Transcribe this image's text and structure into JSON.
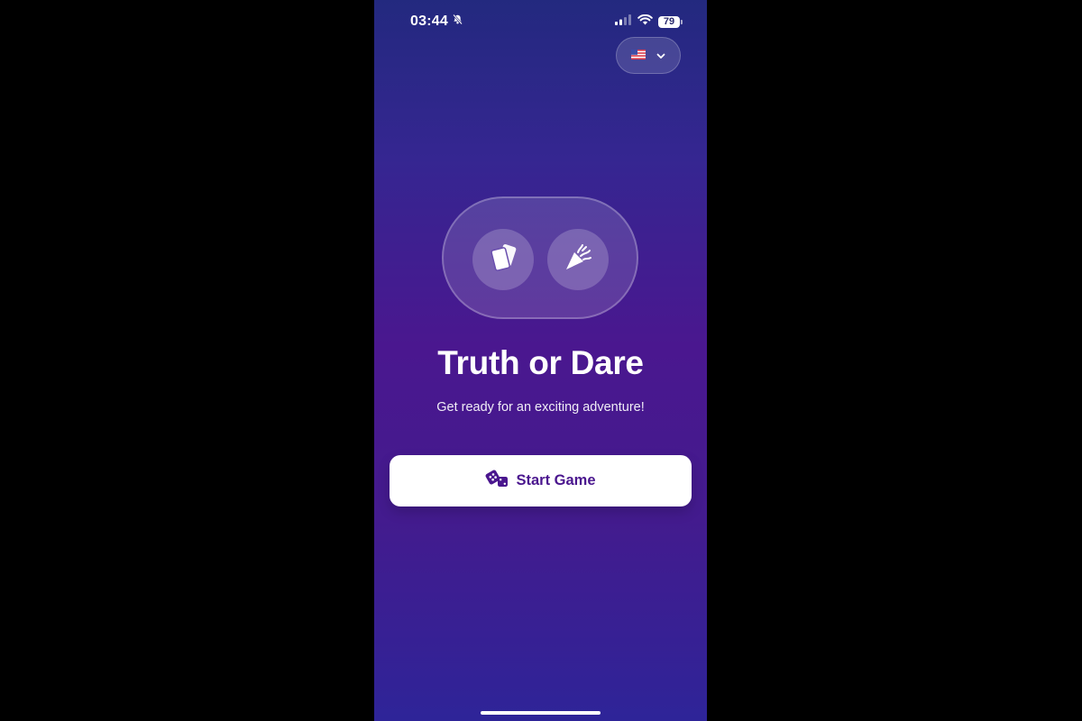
{
  "status_bar": {
    "time": "03:44",
    "battery": "79",
    "icons": [
      "bell-slash-icon",
      "signal-icon",
      "wifi-icon",
      "battery-icon"
    ]
  },
  "language_selector": {
    "flag": "🇺🇸",
    "icon": "chevron-down-icon"
  },
  "hero": {
    "left_icon": "cards-icon",
    "right_icon": "party-popper-icon"
  },
  "main": {
    "title": "Truth or Dare",
    "subtitle": "Get ready for an exciting adventure!"
  },
  "start_button": {
    "icon": "dice-icon",
    "label": "Start Game"
  },
  "colors": {
    "background_top": "#23297f",
    "background_mid": "#4a178f",
    "background_bottom": "#2e2498",
    "button_text": "#4a168e"
  }
}
